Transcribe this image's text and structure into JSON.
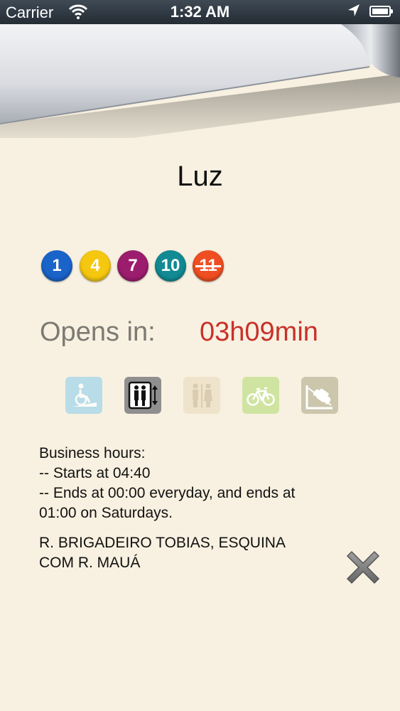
{
  "status_bar": {
    "carrier": "Carrier",
    "time": "1:32 AM",
    "icons": [
      "wifi-icon",
      "location-arrow-icon",
      "battery-icon"
    ]
  },
  "station": {
    "name": "Luz"
  },
  "lines": [
    {
      "number": "1",
      "color": "#1a63c9"
    },
    {
      "number": "4",
      "color": "#f5c80f"
    },
    {
      "number": "7",
      "color": "#9c1d6e"
    },
    {
      "number": "10",
      "color": "#118a93"
    },
    {
      "number": "11",
      "color": "#ef4e22"
    }
  ],
  "opening": {
    "label": "Opens in:",
    "value": "03h09min",
    "value_color": "#c8312a"
  },
  "amenities": [
    {
      "icon": "wheelchair-ramp-icon",
      "active": false,
      "color": "#a9d8ea"
    },
    {
      "icon": "elevator-icon",
      "active": true,
      "color": "#8f8f8f"
    },
    {
      "icon": "restroom-icon",
      "active": false,
      "color": "#e8dcc2"
    },
    {
      "icon": "bicycle-icon",
      "active": false,
      "color": "#cfe4a1"
    },
    {
      "icon": "parking-car-icon",
      "active": false,
      "color": "#cbc6ac"
    }
  ],
  "business_hours": {
    "title": "Business hours:",
    "starts": "-- Starts at 04:40",
    "ends_line1": "-- Ends at 00:00 everyday, and ends at",
    "ends_line2": "01:00 on Saturdays."
  },
  "address": {
    "line1": "R. BRIGADEIRO TOBIAS, ESQUINA",
    "line2": "COM R. MAUÁ"
  }
}
